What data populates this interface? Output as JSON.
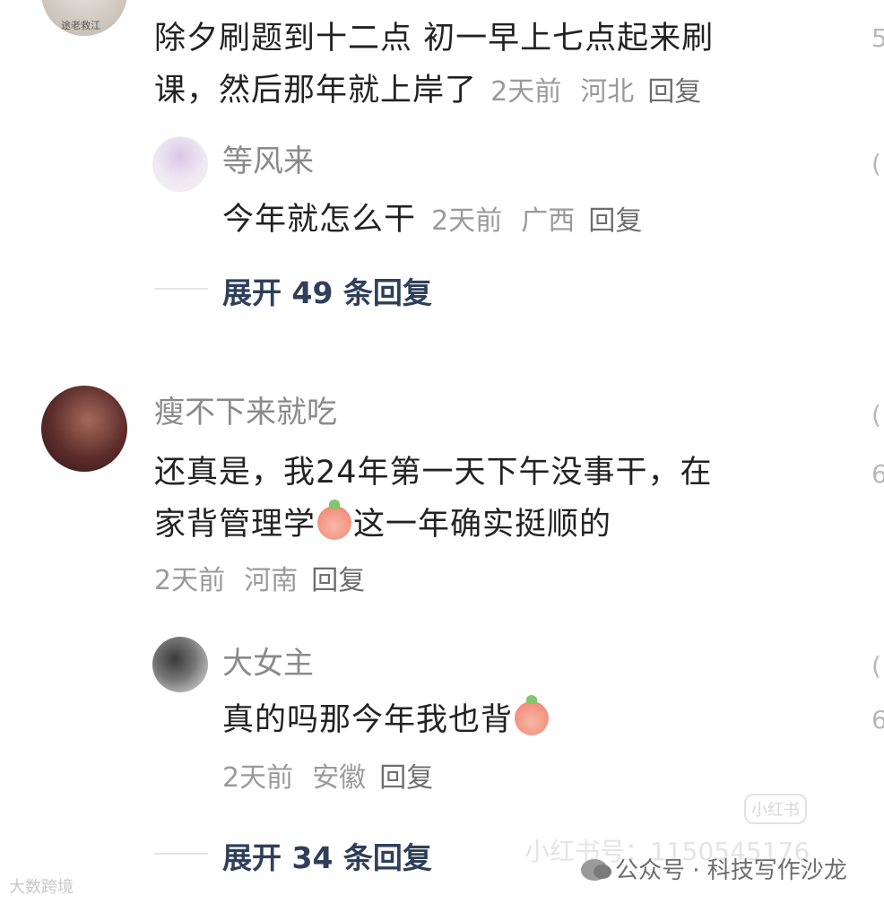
{
  "comment1": {
    "line1": "除夕刷题到十二点 初一早上七点起来刷",
    "line2": "课，然后那年就上岸了",
    "time": "2天前",
    "location": "河北",
    "reply": "回复",
    "avatar_tag": "途老救江"
  },
  "reply1": {
    "name": "等风来",
    "content": "今年就怎么干",
    "time": "2天前",
    "location": "广西",
    "reply": "回复"
  },
  "expand1": "展开 49 条回复",
  "comment2": {
    "name": "瘦不下来就吃",
    "line1": "还真是，我24年第一天下午没事干，在",
    "line2_a": "家背管理学",
    "line2_b": "这一年确实挺顺的",
    "time": "2天前",
    "location": "河南",
    "reply": "回复"
  },
  "reply2": {
    "name": "大女主",
    "content": "真的吗那今年我也背",
    "time": "2天前",
    "location": "安徽",
    "reply": "回复"
  },
  "expand2": "展开 34 条回复",
  "watermarks": {
    "left": "大数跨境",
    "app_badge": "小红书",
    "app_id": "小红书号：1150545176",
    "wechat": "公众号 · 科技写作沙龙"
  },
  "colors": {
    "expand": "#2f3f5a",
    "meta": "#9a9a9a",
    "name": "#8a8a8a"
  },
  "icons": [
    "cry-laugh-emoji",
    "shy-emoji",
    "wechat-icon",
    "like-icon"
  ]
}
